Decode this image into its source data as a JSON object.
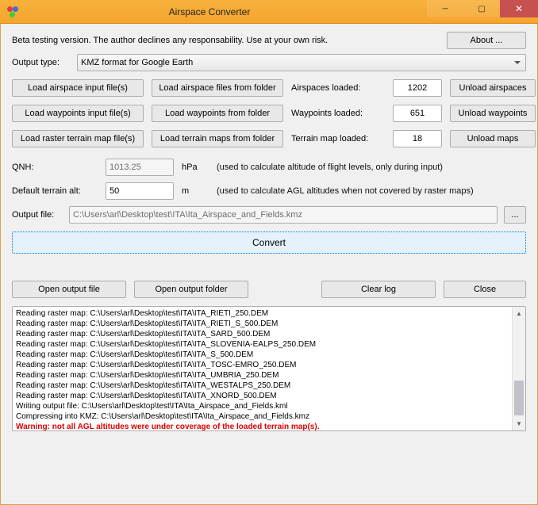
{
  "window": {
    "title": "Airspace Converter"
  },
  "disclaimer": "Beta testing version. The author declines any responsability. Use at your own risk.",
  "about": "About ...",
  "output_type_label": "Output type:",
  "output_type_value": "KMZ format for Google Earth",
  "load": {
    "row1": {
      "a": "Load airspace input file(s)",
      "b": "Load airspace files from folder",
      "lbl": "Airspaces loaded:",
      "val": "1202",
      "unload": "Unload airspaces"
    },
    "row2": {
      "a": "Load waypoints input file(s)",
      "b": "Load waypoints from folder",
      "lbl": "Waypoints loaded:",
      "val": "651",
      "unload": "Unload waypoints"
    },
    "row3": {
      "a": "Load raster terrain map file(s)",
      "b": "Load terrain maps from folder",
      "lbl": "Terrain map loaded:",
      "val": "18",
      "unload": "Unload maps"
    }
  },
  "qnh": {
    "label": "QNH:",
    "value": "1013.25",
    "unit": "hPa",
    "hint": "(used to calculate altitude of flight levels, only during input)"
  },
  "terrain": {
    "label": "Default terrain alt:",
    "value": "50",
    "unit": "m",
    "hint": "(used to calculate AGL altitudes when not covered by raster maps)"
  },
  "outfile": {
    "label": "Output file:",
    "value": "C:\\Users\\arl\\Desktop\\test\\ITA\\Ita_Airspace_and_Fields.kmz",
    "browse": "..."
  },
  "convert": "Convert",
  "toolbar": {
    "open_file": "Open output file",
    "open_folder": "Open output folder",
    "clear": "Clear log",
    "close": "Close"
  },
  "log": [
    {
      "t": "Reading raster map: C:\\Users\\arl\\Desktop\\test\\ITA\\ITA_RIETI_250.DEM",
      "warn": false
    },
    {
      "t": "Reading raster map: C:\\Users\\arl\\Desktop\\test\\ITA\\ITA_RIETI_S_500.DEM",
      "warn": false
    },
    {
      "t": "Reading raster map: C:\\Users\\arl\\Desktop\\test\\ITA\\ITA_SARD_500.DEM",
      "warn": false
    },
    {
      "t": "Reading raster map: C:\\Users\\arl\\Desktop\\test\\ITA\\ITA_SLOVENIA-EALPS_250.DEM",
      "warn": false
    },
    {
      "t": "Reading raster map: C:\\Users\\arl\\Desktop\\test\\ITA\\ITA_S_500.DEM",
      "warn": false
    },
    {
      "t": "Reading raster map: C:\\Users\\arl\\Desktop\\test\\ITA\\ITA_TOSC-EMRO_250.DEM",
      "warn": false
    },
    {
      "t": "Reading raster map: C:\\Users\\arl\\Desktop\\test\\ITA\\ITA_UMBRIA_250.DEM",
      "warn": false
    },
    {
      "t": "Reading raster map: C:\\Users\\arl\\Desktop\\test\\ITA\\ITA_WESTALPS_250.DEM",
      "warn": false
    },
    {
      "t": "Reading raster map: C:\\Users\\arl\\Desktop\\test\\ITA\\ITA_XNORD_500.DEM",
      "warn": false
    },
    {
      "t": "Writing output file: C:\\Users\\arl\\Desktop\\test\\ITA\\Ita_Airspace_and_Fields.kml",
      "warn": false
    },
    {
      "t": "Compressing into KMZ: C:\\Users\\arl\\Desktop\\test\\ITA\\Ita_Airspace_and_Fields.kmz",
      "warn": false
    },
    {
      "t": "Warning: not all AGL altitudes were under coverage of the loaded terrain map(s).",
      "warn": true
    }
  ],
  "scroll": {
    "thumb_top_pct": 62,
    "thumb_height_pct": 36
  }
}
